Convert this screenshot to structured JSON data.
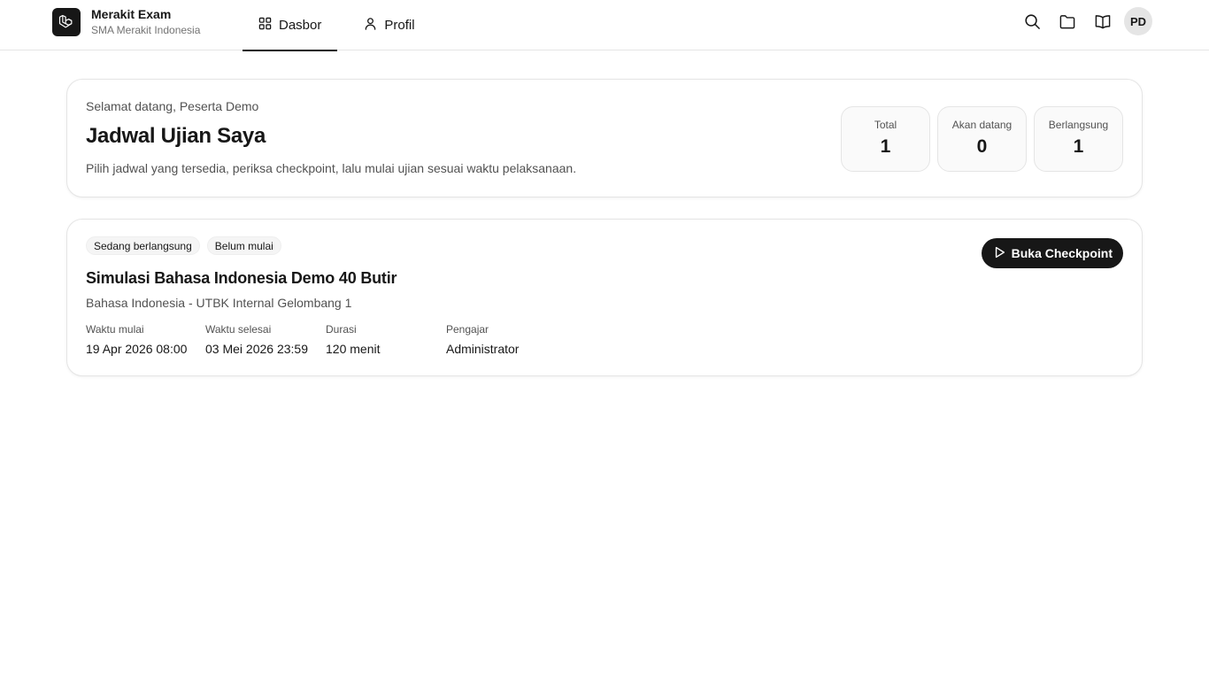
{
  "brand": {
    "name": "Merakit Exam",
    "school": "SMA Merakit Indonesia",
    "logo_icon": "laravel-logo-icon"
  },
  "nav": {
    "items": [
      {
        "label": "Dasbor",
        "icon": "grid-icon",
        "active": true
      },
      {
        "label": "Profil",
        "icon": "user-icon",
        "active": false
      }
    ]
  },
  "tools": {
    "icons": [
      "search-icon",
      "folder-icon",
      "book-open-icon"
    ],
    "avatar_initials": "PD"
  },
  "welcome": {
    "greeting": "Selamat datang, Peserta Demo",
    "title": "Jadwal Ujian Saya",
    "description": "Pilih jadwal yang tersedia, periksa checkpoint, lalu mulai ujian sesuai waktu pelaksanaan.",
    "stats": [
      {
        "label": "Total",
        "value": "1"
      },
      {
        "label": "Akan datang",
        "value": "0"
      },
      {
        "label": "Berlangsung",
        "value": "1"
      }
    ]
  },
  "exam": {
    "badges": [
      "Sedang berlangsung",
      "Belum mulai"
    ],
    "title": "Simulasi Bahasa Indonesia Demo 40 Butir",
    "subtitle": "Bahasa Indonesia - UTBK Internal Gelombang 1",
    "meta": [
      {
        "label": "Waktu mulai",
        "value": "19 Apr 2026 08:00"
      },
      {
        "label": "Waktu selesai",
        "value": "03 Mei 2026 23:59"
      },
      {
        "label": "Durasi",
        "value": "120 menit"
      },
      {
        "label": "Pengajar",
        "value": "Administrator"
      }
    ],
    "button_label": "Buka Checkpoint",
    "button_icon": "play-icon"
  },
  "colors": {
    "primary": "#171717",
    "muted_text": "#525252",
    "border": "#e5e5e5",
    "surface": "#fafafa"
  }
}
